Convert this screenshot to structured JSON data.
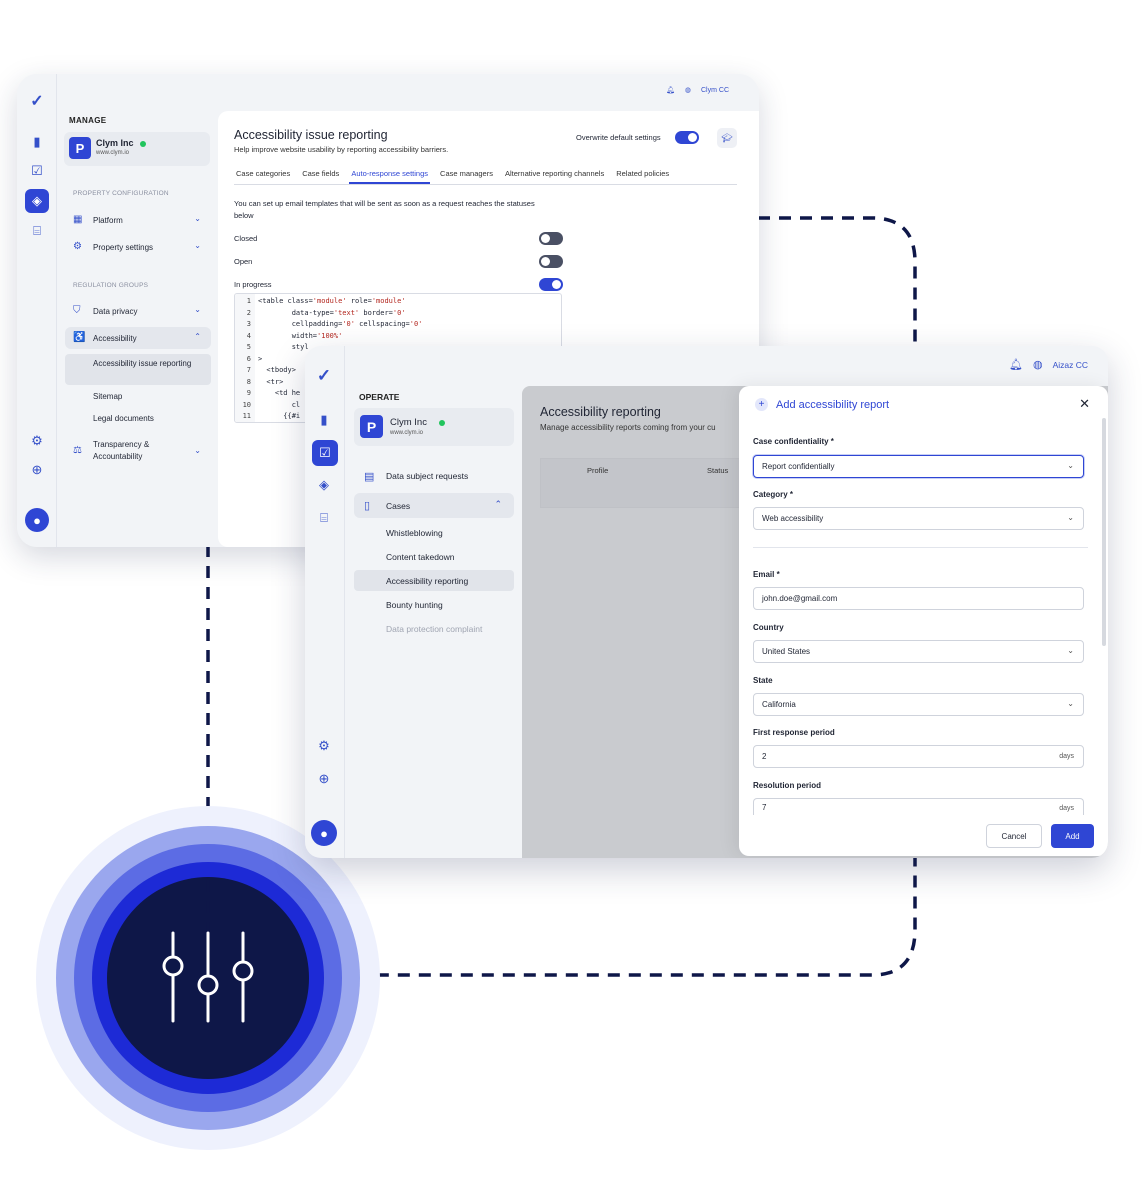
{
  "back_window": {
    "topbar": {
      "account": "Clym CC"
    },
    "sidebar": {
      "section_title": "MANAGE",
      "org": {
        "name": "Clym Inc",
        "site": "www.clym.io",
        "logo_letter": "P"
      },
      "property_config_header": "PROPERTY CONFIGURATION",
      "items_top": [
        {
          "label": "Platform",
          "icon": "grid-icon"
        },
        {
          "label": "Property settings",
          "icon": "gear-icon"
        }
      ],
      "regulation_header": "REGULATION GROUPS",
      "items_reg": [
        {
          "label": "Data privacy",
          "icon": "shield-icon"
        },
        {
          "label": "Accessibility",
          "icon": "accessibility-icon"
        }
      ],
      "accessibility_sub": [
        "Accessibility issue reporting",
        "Sitemap",
        "Legal documents"
      ],
      "transparency": "Transparency & Accountability"
    },
    "content": {
      "title": "Accessibility issue reporting",
      "subtitle": "Help improve website usability by reporting accessibility barriers.",
      "overwrite_label": "Overwrite default settings",
      "tabs": [
        "Case categories",
        "Case fields",
        "Auto-response settings",
        "Case managers",
        "Alternative reporting channels",
        "Related policies"
      ],
      "active_tab": "Auto-response settings",
      "description": "You can set up email templates that will be sent as soon as a request reaches the statuses below",
      "statuses": [
        {
          "label": "Closed",
          "on": false
        },
        {
          "label": "Open",
          "on": false
        },
        {
          "label": "In progress",
          "on": true
        }
      ],
      "code_line_numbers": [
        "1",
        "2",
        "3",
        "4",
        "5",
        "6",
        "7",
        "8",
        "9",
        "10",
        "11"
      ]
    }
  },
  "front_window": {
    "topbar": {
      "account": "Aizaz CC"
    },
    "sidebar": {
      "section_title": "OPERATE",
      "org": {
        "name": "Clym Inc",
        "site": "www.clym.io",
        "logo_letter": "P"
      },
      "items": [
        {
          "label": "Data subject requests",
          "icon": "chat-icon"
        },
        {
          "label": "Cases",
          "icon": "document-icon"
        }
      ],
      "case_sub": [
        "Whistleblowing",
        "Content takedown",
        "Accessibility reporting",
        "Bounty hunting",
        "Data protection complaint"
      ]
    },
    "main": {
      "title": "Accessibility reporting",
      "subtitle": "Manage accessibility reports coming from your cu",
      "columns": [
        "Profile",
        "Status"
      ]
    },
    "modal": {
      "title": "Add accessibility report",
      "fields": {
        "case_confidentiality": {
          "label": "Case confidentiality *",
          "value": "Report confidentially"
        },
        "category": {
          "label": "Category *",
          "value": "Web accessibility"
        },
        "email": {
          "label": "Email *",
          "value": "john.doe@gmail.com"
        },
        "country": {
          "label": "Country",
          "value": "United States"
        },
        "state": {
          "label": "State",
          "value": "California"
        },
        "first_response": {
          "label": "First response period",
          "value": "2",
          "unit": "days"
        },
        "resolution": {
          "label": "Resolution period",
          "value": "7",
          "unit": "days"
        }
      },
      "cancel_label": "Cancel",
      "add_label": "Add"
    }
  },
  "colors": {
    "brand": "#2f46d4",
    "navy": "#0e1748",
    "success": "#21c45d"
  }
}
